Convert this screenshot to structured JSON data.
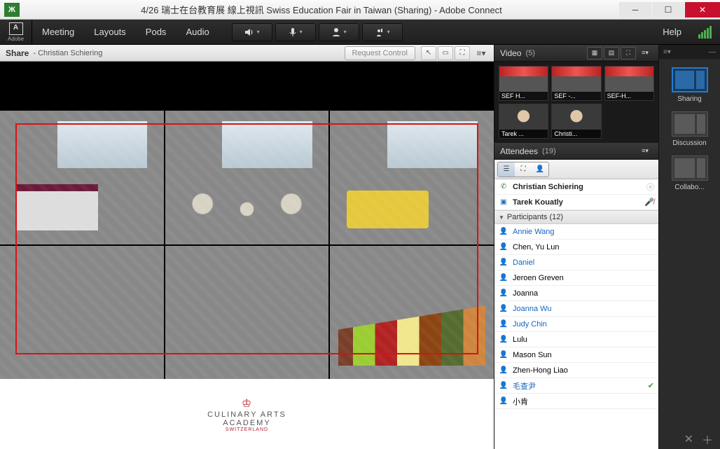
{
  "window": {
    "title": "4/26 瑞士在台教育展 線上視訊  Swiss Education Fair in Taiwan (Sharing) - Adobe Connect",
    "app_badge": "Ж"
  },
  "menubar": {
    "brand": "Adobe",
    "brand_initial": "A",
    "items": {
      "meeting": "Meeting",
      "layouts": "Layouts",
      "pods": "Pods",
      "audio": "Audio"
    },
    "help": "Help"
  },
  "share": {
    "title": "Share",
    "presenter": "- Christian Schiering",
    "request_control": "Request Control",
    "slide": {
      "logo_crest": "♔",
      "logo_line1": "CULINARY ARTS",
      "logo_line2": "ACADEMY",
      "logo_line3": "SWITZERLAND"
    }
  },
  "video": {
    "title": "Video",
    "count": "(5)",
    "feeds": [
      {
        "label": "SEF H..."
      },
      {
        "label": "SEF -..."
      },
      {
        "label": "SEF-H..."
      },
      {
        "label": "Tarek ..."
      },
      {
        "label": "Christi..."
      }
    ]
  },
  "attendees": {
    "title": "Attendees",
    "count": "(19)",
    "hosts": [
      {
        "name": "Christian Schiering",
        "icon": "phone",
        "tail": "x"
      },
      {
        "name": "Tarek Kouatly",
        "icon": "screen",
        "tail": "mic-mute"
      }
    ],
    "section_label": "Participants (12)",
    "participants": [
      {
        "name": "Annie Wang",
        "link": true
      },
      {
        "name": "Chen, Yu Lun",
        "link": false
      },
      {
        "name": "Daniel",
        "link": true
      },
      {
        "name": "Jeroen Greven",
        "link": false
      },
      {
        "name": "Joanna",
        "link": false
      },
      {
        "name": "Joanna Wu",
        "link": true
      },
      {
        "name": "Judy Chin",
        "link": true
      },
      {
        "name": "Lulu",
        "link": false
      },
      {
        "name": "Mason Sun",
        "link": false
      },
      {
        "name": "Zhen-Hong Liao",
        "link": false
      },
      {
        "name": "毛查尹",
        "link": true,
        "tail": "check"
      },
      {
        "name": "小肯",
        "link": false
      }
    ]
  },
  "layouts": {
    "items": [
      {
        "label": "Sharing",
        "active": true
      },
      {
        "label": "Discussion",
        "active": false
      },
      {
        "label": "Collabo...",
        "active": false
      }
    ]
  }
}
